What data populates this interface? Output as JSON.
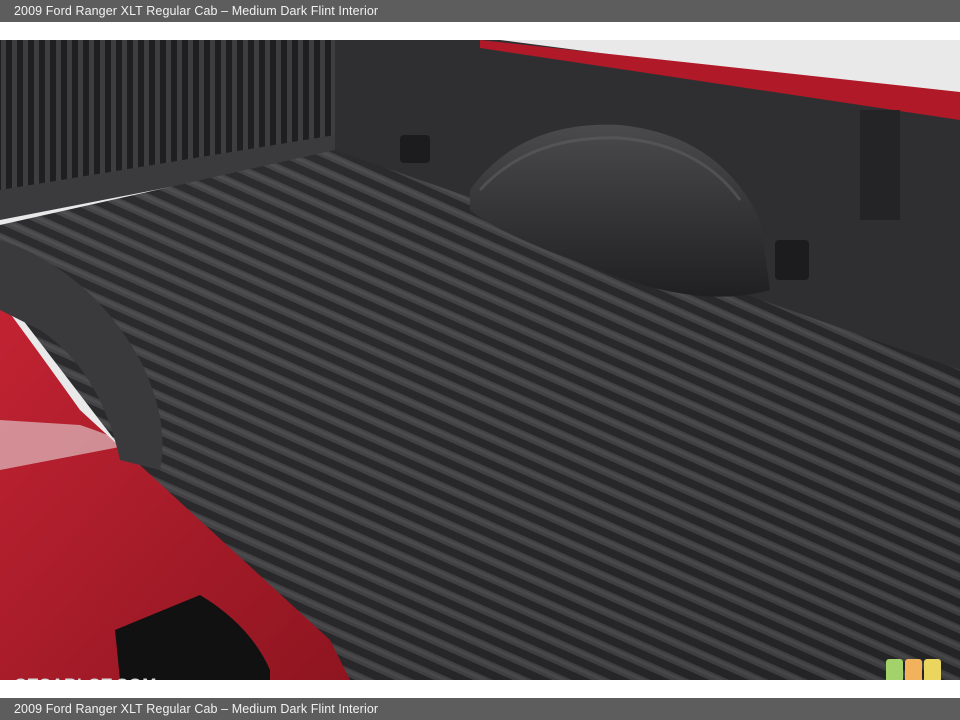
{
  "header": {
    "caption": "2009 Ford Ranger XLT Regular Cab – Medium Dark Flint Interior"
  },
  "footer": {
    "caption": "2009 Ford Ranger XLT Regular Cab – Medium Dark Flint Interior"
  },
  "watermark": {
    "text": "GTCARLOT.COM"
  },
  "colors": {
    "caption_bar": "#5d5d5d",
    "paint_red": "#b51d2c",
    "liner_dark": "#2b2b2d",
    "watermark_green": "#a3d16a",
    "watermark_orange": "#f2b25c",
    "watermark_yellow": "#ead65f"
  }
}
